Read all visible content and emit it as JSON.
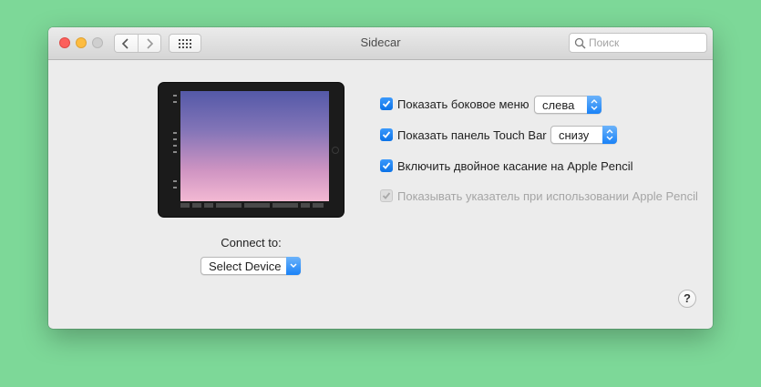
{
  "window": {
    "title": "Sidecar"
  },
  "search": {
    "placeholder": "Поиск"
  },
  "connect": {
    "label": "Connect to:",
    "device": "Select Device"
  },
  "options": [
    {
      "label": "Показать боковое меню",
      "checked": true,
      "select": "слева"
    },
    {
      "label": "Показать панель Touch Bar",
      "checked": true,
      "select": "снизу"
    },
    {
      "label": "Включить двойное касание на Apple Pencil",
      "checked": true
    },
    {
      "label": "Показывать указатель при использовании Apple Pencil",
      "checked": true,
      "disabled": true
    }
  ],
  "help": {
    "label": "?"
  },
  "colors": {
    "accent": "#1a82f7",
    "background": "#7dd898",
    "window": "#ececec"
  },
  "icons": [
    "back-icon",
    "forward-icon",
    "grid-icon",
    "search-icon",
    "checkmark-icon",
    "chevron-updown-icon"
  ]
}
